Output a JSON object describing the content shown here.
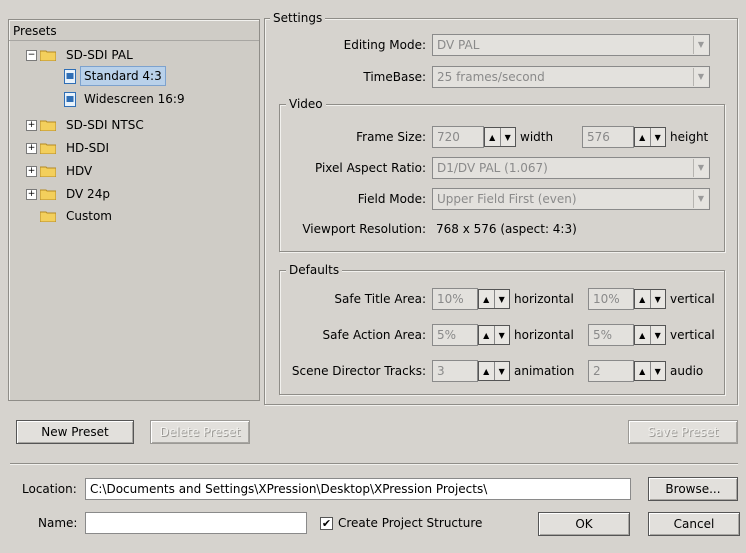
{
  "presets": {
    "title": "Presets",
    "tree": [
      {
        "label": "SD-SDI PAL",
        "expanded": true,
        "children": [
          {
            "label": "Standard 4:3",
            "selected": true
          },
          {
            "label": "Widescreen 16:9"
          }
        ]
      },
      {
        "label": "SD-SDI NTSC",
        "expanded": false
      },
      {
        "label": "HD-SDI",
        "expanded": false
      },
      {
        "label": "HDV",
        "expanded": false
      },
      {
        "label": "DV 24p",
        "expanded": false
      },
      {
        "label": "Custom"
      }
    ]
  },
  "settings": {
    "legend": "Settings",
    "editing_mode_label": "Editing Mode:",
    "editing_mode_value": "DV PAL",
    "timebase_label": "TimeBase:",
    "timebase_value": "25 frames/second"
  },
  "video": {
    "legend": "Video",
    "frame_size_label": "Frame Size:",
    "width_value": "720",
    "width_label": "width",
    "height_value": "576",
    "height_label": "height",
    "par_label": "Pixel Aspect Ratio:",
    "par_value": "D1/DV PAL (1.067)",
    "field_mode_label": "Field Mode:",
    "field_mode_value": "Upper Field First (even)",
    "viewport_label": "Viewport Resolution:",
    "viewport_value": "768 x 576  (aspect: 4:3)"
  },
  "defaults": {
    "legend": "Defaults",
    "safe_title_label": "Safe Title Area:",
    "safe_title_h": "10%",
    "horizontal_label": "horizontal",
    "safe_title_v": "10%",
    "vertical_label": "vertical",
    "safe_action_label": "Safe Action Area:",
    "safe_action_h": "5%",
    "safe_action_v": "5%",
    "scene_tracks_label": "Scene Director Tracks:",
    "animation_value": "3",
    "animation_label": "animation",
    "audio_value": "2",
    "audio_label": "audio"
  },
  "buttons": {
    "new_preset": "New Preset",
    "delete_preset": "Delete Preset",
    "save_preset": "Save Preset",
    "browse": "Browse...",
    "ok": "OK",
    "cancel": "Cancel"
  },
  "footer": {
    "location_label": "Location:",
    "location_value": "C:\\Documents and Settings\\XPression\\Desktop\\XPression Projects\\",
    "name_label": "Name:",
    "name_value": "",
    "create_structure_label": "Create Project Structure",
    "create_structure_checked": true
  }
}
